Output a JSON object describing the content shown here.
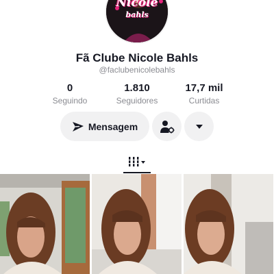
{
  "avatar": {
    "logo_line1": "Nicole",
    "logo_line2": "bahls",
    "ring_color": "#e3247b"
  },
  "profile": {
    "name": "Fã Clube Nicole Bahls",
    "handle": "@faclubenicolebahls"
  },
  "stats": [
    {
      "value": "0",
      "label": "Seguindo"
    },
    {
      "value": "1.810",
      "label": "Seguidores"
    },
    {
      "value": "17,7 mil",
      "label": "Curtidas"
    }
  ],
  "actions": {
    "message_label": "Mensagem",
    "message_icon": "send-icon",
    "follow_icon": "person-add-icon",
    "more_icon": "chevron-down-icon"
  },
  "tabs": {
    "active_icon": "grid-icon"
  },
  "videos": [
    {
      "thumbnail": "woman-with-bangs-in-room"
    },
    {
      "thumbnail": "woman-with-bangs-on-sofa"
    },
    {
      "thumbnail": "woman-with-bangs-near-window"
    }
  ]
}
